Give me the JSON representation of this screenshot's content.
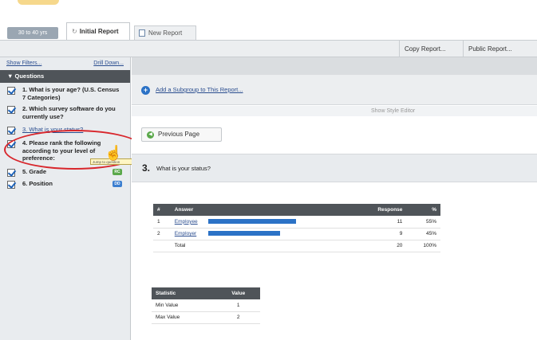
{
  "tabs": {
    "filter_tab": "30 to 40 yrs",
    "initial_tab": "Initial Report",
    "new_tab": "New Report"
  },
  "toolbar": {
    "copy": "Copy Report...",
    "public": "Public Report..."
  },
  "sidebar": {
    "show_filters": "Show Filters...",
    "drill_down": "Drill Down...",
    "header": "Questions",
    "questions": [
      {
        "label": "1. What is your age? (U.S. Census 7 Categories)"
      },
      {
        "label": "2. Which survey software do you currently use?"
      },
      {
        "label": "3. What is your status?"
      },
      {
        "label": "4. Please rank the following according to your level of preference:"
      },
      {
        "label": "5. Grade",
        "badge": "RC",
        "badge_color": "#5aa84a"
      },
      {
        "label": "6. Position",
        "badge": "DD",
        "badge_color": "#3b7ed0"
      }
    ],
    "tooltip": "Jump to question"
  },
  "main": {
    "add_subgroup": "Add a Subgroup to This Report...",
    "style_editor": "Show Style Editor",
    "previous_page": "Previous Page",
    "question_number": "3.",
    "question_text": "What is your status?"
  },
  "response_table": {
    "headers": [
      "#",
      "Answer",
      "Response",
      "%"
    ],
    "rows": [
      {
        "num": "1",
        "answer": "Employee",
        "response": "11",
        "pct": "55%",
        "share": 0.55
      },
      {
        "num": "2",
        "answer": "Employer",
        "response": "9",
        "pct": "45%",
        "share": 0.45
      }
    ],
    "total_label": "Total",
    "total_response": "20",
    "total_pct": "100%"
  },
  "stat_table": {
    "headers": [
      "Statistic",
      "Value"
    ],
    "rows": [
      {
        "label": "Min Value",
        "value": "1"
      },
      {
        "label": "Max Value",
        "value": "2"
      }
    ]
  },
  "colors": {
    "accent": "#2b72c6",
    "highlight_ring": "#d8262c",
    "header_dark": "#4f5459"
  }
}
